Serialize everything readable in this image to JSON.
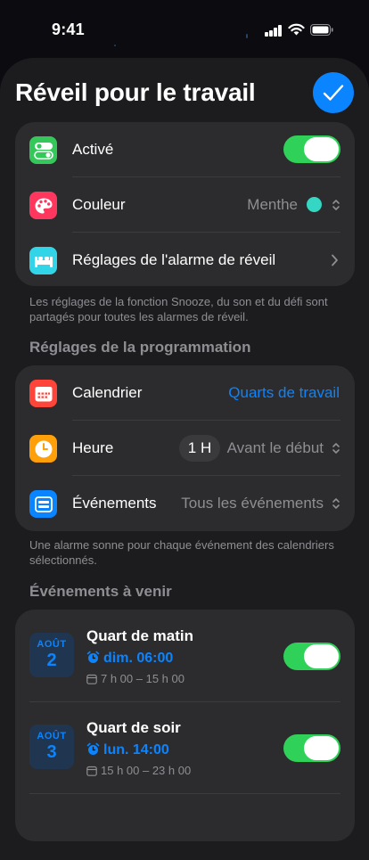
{
  "status": {
    "time": "9:41"
  },
  "header": {
    "title": "Réveil pour le travail",
    "done_icon": "checkmark-icon"
  },
  "main_card": {
    "active": {
      "label": "Activé",
      "on": true,
      "icon": "toggle-icon",
      "icon_color": "#34c759"
    },
    "color": {
      "label": "Couleur",
      "value": "Menthe",
      "swatch": "#35d6c4",
      "icon": "palette-icon",
      "icon_color": "#ff375f"
    },
    "settings": {
      "label": "Réglages de l'alarme de réveil",
      "icon": "bed-icon",
      "icon_color": "#32d4e8"
    }
  },
  "note1": "Les réglages de la fonction Snooze, du son et du défi sont partagés pour toutes les alarmes de réveil.",
  "schedule": {
    "heading": "Réglages de la programmation",
    "calendar": {
      "label": "Calendrier",
      "value": "Quarts de travail",
      "icon": "calendar-icon",
      "icon_color": "#ff453a"
    },
    "time": {
      "label": "Heure",
      "offset": "1 H",
      "value": "Avant le début",
      "icon": "clock-icon",
      "icon_color": "#ff9f0a"
    },
    "events": {
      "label": "Événements",
      "value": "Tous les événements",
      "icon": "events-icon",
      "icon_color": "#0a84ff"
    }
  },
  "note2": "Une alarme sonne pour chaque événement des calendriers sélectionnés.",
  "upcoming": {
    "heading": "Événements à venir",
    "items": [
      {
        "month": "AOÛT",
        "day": "2",
        "title": "Quart de matin",
        "alarm": "dim. 06:00",
        "hours": "7 h 00 – 15 h 00",
        "on": true
      },
      {
        "month": "AOÛT",
        "day": "3",
        "title": "Quart de soir",
        "alarm": "lun. 14:00",
        "hours": "15 h 00 – 23 h 00",
        "on": true
      }
    ]
  },
  "colors": {
    "accent": "#0a84ff",
    "toggle_on": "#30d158",
    "card": "#2c2c2e",
    "sheet": "#1c1c1e"
  }
}
